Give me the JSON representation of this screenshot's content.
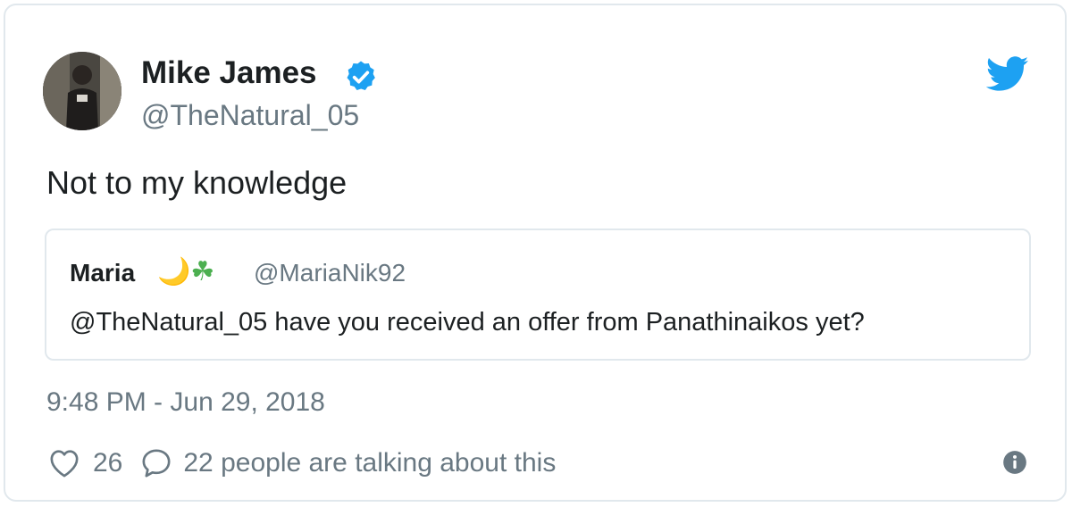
{
  "author": {
    "name": "Mike James",
    "handle": "@TheNatural_05",
    "verified_icon": "verified-badge-icon",
    "verified_color": "#1da1f2"
  },
  "brand": {
    "icon": "twitter-bird-icon",
    "color": "#1da1f2"
  },
  "tweet": {
    "text": "Not to my knowledge",
    "timestamp": "9:48 PM - Jun 29, 2018"
  },
  "quoted": {
    "name": "Maria",
    "emoji_moon": "🌙",
    "emoji_shamrock": "☘",
    "handle": "@MariaNik92",
    "text": "@TheNatural_05 have you received an offer from Panathinaikos yet?"
  },
  "actions": {
    "like_icon": "heart-icon",
    "like_count": "26",
    "reply_icon": "speech-bubble-icon",
    "reply_text": "22 people are talking about this",
    "info_icon": "info-icon"
  },
  "colors": {
    "text_primary": "#1c2022",
    "text_secondary": "#697882",
    "border": "#e1e8ed"
  }
}
